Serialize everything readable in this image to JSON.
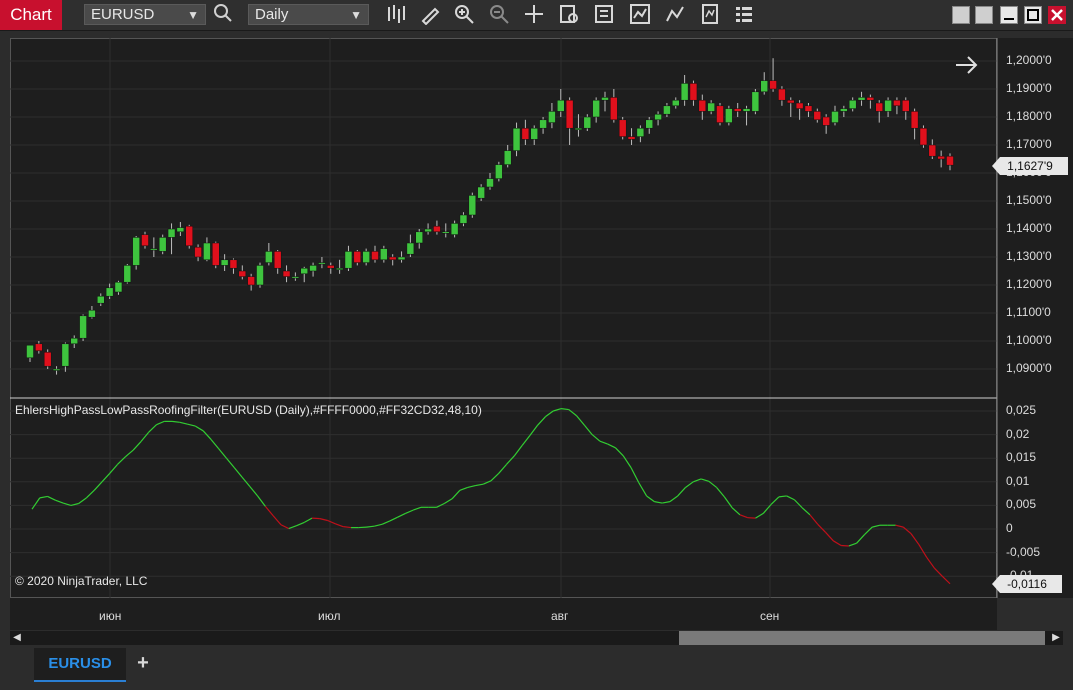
{
  "window": {
    "label": "Chart"
  },
  "toolbar": {
    "instrument": "EURUSD",
    "interval": "Daily",
    "icons": [
      "bars-type-icon",
      "draw-tool-icon",
      "zoom-in-icon",
      "zoom-out-icon",
      "crosshair-icon",
      "data-box-icon",
      "properties-icon",
      "indicators-icon",
      "strategies-icon",
      "templates-icon",
      "menu-icon"
    ]
  },
  "price_axis": {
    "labels": [
      "1,2000'0",
      "1,1900'0",
      "1,1800'0",
      "1,1700'0",
      "1,1600'0",
      "1,1500'0",
      "1,1400'0",
      "1,1300'0",
      "1,1200'0",
      "1,1100'0",
      "1,1000'0",
      "1,0900'0"
    ],
    "current_price": "1,1627'9"
  },
  "oscillator_axis": {
    "labels": [
      "0,025",
      "0,02",
      "0,015",
      "0,01",
      "0,005",
      "0",
      "-0,005",
      "-0,01"
    ],
    "current_value": "-0,0116"
  },
  "indicator": {
    "title": "EhlersHighPassLowPassRoofingFilter(EURUSD (Daily),#FFFF0000,#FF32CD32,48,10)",
    "up_color": "#32CD32",
    "down_color": "#FF0000"
  },
  "copyright": "© 2020 NinjaTrader, LLC",
  "time_axis": {
    "labels": [
      "июн",
      "июл",
      "авг",
      "сен"
    ]
  },
  "tabs": {
    "active": "EURUSD",
    "add_label": "+"
  },
  "colors": {
    "bull": "#3ec43e",
    "bear": "#e0101c",
    "background": "#1e1e1e",
    "accent_tab": "#2a8fe8"
  },
  "chart_data": [
    {
      "type": "candlestick",
      "title": "",
      "ylim": [
        1.085,
        1.205
      ],
      "candles": [
        [
          1.094,
          1.0985,
          1.0925,
          1.0985
        ],
        [
          1.099,
          1.0965,
          1.1,
          1.0955
        ],
        [
          1.096,
          1.091,
          1.097,
          1.09
        ],
        [
          1.09,
          1.09,
          1.091,
          1.088
        ],
        [
          1.091,
          1.099,
          1.0995,
          1.089
        ],
        [
          1.099,
          1.101,
          1.102,
          1.0975
        ],
        [
          1.101,
          1.109,
          1.1095,
          1.1
        ],
        [
          1.1085,
          1.111,
          1.1125,
          1.108
        ],
        [
          1.1135,
          1.116,
          1.117,
          1.1125
        ],
        [
          1.116,
          1.119,
          1.1205,
          1.115
        ],
        [
          1.1175,
          1.121,
          1.1215,
          1.1165
        ],
        [
          1.121,
          1.127,
          1.1275,
          1.1205
        ],
        [
          1.127,
          1.137,
          1.1375,
          1.1255
        ],
        [
          1.138,
          1.134,
          1.139,
          1.133
        ],
        [
          1.133,
          1.133,
          1.137,
          1.13
        ],
        [
          1.132,
          1.137,
          1.138,
          1.131
        ],
        [
          1.137,
          1.14,
          1.142,
          1.131
        ],
        [
          1.139,
          1.1405,
          1.1425,
          1.1375
        ],
        [
          1.141,
          1.134,
          1.1415,
          1.133
        ],
        [
          1.1335,
          1.13,
          1.1345,
          1.1285
        ],
        [
          1.129,
          1.135,
          1.137,
          1.1285
        ],
        [
          1.135,
          1.127,
          1.1355,
          1.126
        ],
        [
          1.127,
          1.129,
          1.131,
          1.125
        ],
        [
          1.129,
          1.126,
          1.1295,
          1.124
        ],
        [
          1.125,
          1.123,
          1.127,
          1.122
        ],
        [
          1.123,
          1.12,
          1.124,
          1.118
        ],
        [
          1.12,
          1.127,
          1.128,
          1.119
        ],
        [
          1.128,
          1.132,
          1.135,
          1.127
        ],
        [
          1.132,
          1.126,
          1.1325,
          1.124
        ],
        [
          1.125,
          1.123,
          1.127,
          1.121
        ],
        [
          1.1225,
          1.123,
          1.1245,
          1.1215
        ],
        [
          1.124,
          1.126,
          1.1265,
          1.121
        ],
        [
          1.125,
          1.127,
          1.128,
          1.123
        ],
        [
          1.128,
          1.128,
          1.13,
          1.126
        ],
        [
          1.127,
          1.126,
          1.128,
          1.124
        ],
        [
          1.126,
          1.126,
          1.129,
          1.124
        ],
        [
          1.126,
          1.132,
          1.134,
          1.125
        ],
        [
          1.132,
          1.128,
          1.1325,
          1.127
        ],
        [
          1.128,
          1.132,
          1.133,
          1.127
        ],
        [
          1.132,
          1.129,
          1.134,
          1.128
        ],
        [
          1.129,
          1.133,
          1.134,
          1.128
        ],
        [
          1.13,
          1.129,
          1.131,
          1.127
        ],
        [
          1.129,
          1.13,
          1.132,
          1.128
        ],
        [
          1.131,
          1.135,
          1.138,
          1.13
        ],
        [
          1.135,
          1.139,
          1.14,
          1.133
        ],
        [
          1.139,
          1.14,
          1.142,
          1.138
        ],
        [
          1.141,
          1.139,
          1.143,
          1.138
        ],
        [
          1.139,
          1.139,
          1.142,
          1.137
        ],
        [
          1.138,
          1.142,
          1.143,
          1.137
        ],
        [
          1.142,
          1.145,
          1.146,
          1.141
        ],
        [
          1.145,
          1.152,
          1.153,
          1.144
        ],
        [
          1.151,
          1.155,
          1.156,
          1.15
        ],
        [
          1.155,
          1.158,
          1.16,
          1.154
        ],
        [
          1.158,
          1.163,
          1.164,
          1.157
        ],
        [
          1.163,
          1.168,
          1.17,
          1.162
        ],
        [
          1.168,
          1.176,
          1.178,
          1.166
        ],
        [
          1.176,
          1.172,
          1.179,
          1.17
        ],
        [
          1.172,
          1.176,
          1.177,
          1.17
        ],
        [
          1.176,
          1.179,
          1.18,
          1.174
        ],
        [
          1.178,
          1.182,
          1.185,
          1.176
        ],
        [
          1.182,
          1.186,
          1.19,
          1.18
        ],
        [
          1.186,
          1.176,
          1.187,
          1.17
        ],
        [
          1.176,
          1.176,
          1.181,
          1.173
        ],
        [
          1.176,
          1.18,
          1.181,
          1.175
        ],
        [
          1.18,
          1.186,
          1.187,
          1.178
        ],
        [
          1.186,
          1.187,
          1.189,
          1.182
        ],
        [
          1.187,
          1.179,
          1.19,
          1.178
        ],
        [
          1.179,
          1.173,
          1.18,
          1.172
        ],
        [
          1.173,
          1.172,
          1.176,
          1.17
        ],
        [
          1.173,
          1.176,
          1.177,
          1.171
        ],
        [
          1.176,
          1.179,
          1.18,
          1.174
        ],
        [
          1.179,
          1.181,
          1.182,
          1.177
        ],
        [
          1.181,
          1.184,
          1.185,
          1.18
        ],
        [
          1.184,
          1.186,
          1.187,
          1.183
        ],
        [
          1.186,
          1.192,
          1.195,
          1.184
        ],
        [
          1.192,
          1.186,
          1.193,
          1.184
        ],
        [
          1.186,
          1.182,
          1.188,
          1.179
        ],
        [
          1.182,
          1.185,
          1.186,
          1.181
        ],
        [
          1.184,
          1.178,
          1.185,
          1.177
        ],
        [
          1.178,
          1.183,
          1.184,
          1.177
        ],
        [
          1.183,
          1.182,
          1.185,
          1.18
        ],
        [
          1.182,
          1.183,
          1.184,
          1.177
        ],
        [
          1.182,
          1.189,
          1.19,
          1.181
        ],
        [
          1.189,
          1.193,
          1.196,
          1.188
        ],
        [
          1.193,
          1.19,
          1.201,
          1.189
        ],
        [
          1.19,
          1.186,
          1.191,
          1.184
        ],
        [
          1.186,
          1.185,
          1.187,
          1.18
        ],
        [
          1.185,
          1.183,
          1.186,
          1.179
        ],
        [
          1.184,
          1.182,
          1.185,
          1.18
        ],
        [
          1.182,
          1.179,
          1.183,
          1.178
        ],
        [
          1.18,
          1.177,
          1.181,
          1.174
        ],
        [
          1.178,
          1.182,
          1.184,
          1.177
        ],
        [
          1.182,
          1.183,
          1.184,
          1.18
        ],
        [
          1.183,
          1.186,
          1.187,
          1.182
        ],
        [
          1.186,
          1.187,
          1.189,
          1.184
        ],
        [
          1.187,
          1.186,
          1.188,
          1.183
        ],
        [
          1.185,
          1.182,
          1.186,
          1.178
        ],
        [
          1.182,
          1.186,
          1.187,
          1.18
        ],
        [
          1.186,
          1.184,
          1.187,
          1.181
        ],
        [
          1.186,
          1.182,
          1.187,
          1.179
        ],
        [
          1.182,
          1.176,
          1.183,
          1.172
        ],
        [
          1.176,
          1.17,
          1.177,
          1.169
        ],
        [
          1.17,
          1.166,
          1.172,
          1.165
        ],
        [
          1.166,
          1.165,
          1.168,
          1.162
        ],
        [
          1.166,
          1.1628,
          1.167,
          1.161
        ]
      ]
    },
    {
      "type": "line",
      "title": "EhlersHighPassLowPassRoofingFilter(EURUSD (Daily),#FFFF0000,#FF32CD32,48,10)",
      "ylim": [
        -0.012,
        0.027
      ],
      "values": [
        0.0042,
        0.0066,
        0.0069,
        0.0061,
        0.0055,
        0.005,
        0.0054,
        0.0066,
        0.0082,
        0.01,
        0.0118,
        0.0137,
        0.0153,
        0.0167,
        0.0185,
        0.0205,
        0.0221,
        0.0228,
        0.0228,
        0.0226,
        0.0222,
        0.0218,
        0.0208,
        0.019,
        0.017,
        0.015,
        0.013,
        0.011,
        0.009,
        0.007,
        0.0048,
        0.0028,
        0.0009,
        0.0001,
        0.0007,
        0.0014,
        0.0023,
        0.0022,
        0.0018,
        0.0011,
        0.0005,
        0.0003,
        0.0003,
        0.0004,
        0.0006,
        0.001,
        0.0017,
        0.0025,
        0.0033,
        0.004,
        0.0046,
        0.0046,
        0.0046,
        0.0054,
        0.0064,
        0.0082,
        0.0088,
        0.0092,
        0.0095,
        0.0102,
        0.0118,
        0.0137,
        0.0155,
        0.0177,
        0.0198,
        0.022,
        0.0238,
        0.025,
        0.0255,
        0.0253,
        0.024,
        0.022,
        0.02,
        0.0186,
        0.018,
        0.0172,
        0.0155,
        0.013,
        0.0098,
        0.007,
        0.0058,
        0.0055,
        0.0058,
        0.007,
        0.0088,
        0.01,
        0.0106,
        0.0101,
        0.0088,
        0.0068,
        0.0045,
        0.003,
        0.0024,
        0.0023,
        0.0033,
        0.0052,
        0.0068,
        0.007,
        0.0062,
        0.0045,
        0.003,
        0.001,
        -0.0007,
        -0.0025,
        -0.0035,
        -0.0036,
        -0.003,
        -0.0012,
        0.0004,
        0.0008,
        0.0008,
        0.0008,
        0.0004,
        -0.001,
        -0.0033,
        -0.006,
        -0.0083,
        -0.01,
        -0.0116
      ]
    }
  ]
}
